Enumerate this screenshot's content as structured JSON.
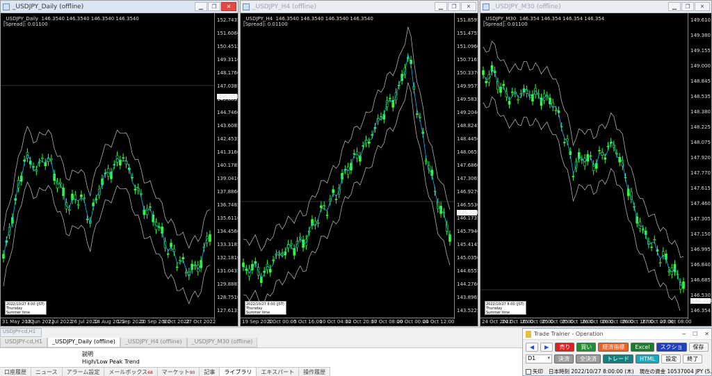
{
  "charts": [
    {
      "title": "_USDJPY_Daily (offline)",
      "info": "_USDJPY_Daily  146.3540 146.3540 146.3540 146.3540\n[Spread]: 0.01100",
      "price_labels": [
        "152.7435",
        "151.6060",
        "150.4515",
        "149.3110",
        "148.1760",
        "147.0385",
        "145.8835",
        "144.7460",
        "143.6085",
        "142.4535",
        "141.3160",
        "140.1785",
        "139.0410",
        "137.8860",
        "136.7485",
        "135.6110",
        "134.4560",
        "133.3185",
        "132.1810",
        "131.0435",
        "129.8885",
        "128.7510",
        "127.6135"
      ],
      "current_price": "146.3540",
      "time_labels": [
        "31 May 2022",
        "19 Jun 2022",
        "7 Jul 2022",
        "26 Jul 2022",
        "14 Aug 2022",
        "1 Sep 2022",
        "20 Sep 2022",
        "9 Oct 2022",
        "27 Oct 2022"
      ]
    },
    {
      "title": "_USDJPY_H4 (offline)",
      "info": "_USDJPY_H4  146.3540 146.3540 146.3540 146.3540\n[Spread]: 0.01100",
      "price_labels": [
        "151.8595",
        "151.4755",
        "151.0960",
        "150.7165",
        "150.3370",
        "149.9575",
        "149.5835",
        "149.2040",
        "148.8245",
        "148.4450",
        "148.0655",
        "147.6860",
        "147.3065",
        "146.9270",
        "146.5530",
        "146.1735",
        "145.7940",
        "145.4145",
        "145.0350",
        "144.6555",
        "144.2760",
        "143.8965",
        "143.5225"
      ],
      "current_price": "146.3540",
      "time_labels": [
        "19 Sep 2022",
        "3 Oct 00:00",
        "5 Oct 16:00",
        "10 Oct 04:00",
        "12 Oct 20:00",
        "17 Oct 08:00",
        "20 Oct 00:00",
        "24 Oct 12:00"
      ]
    },
    {
      "title": "_USDJPY_M30 (offline)",
      "info": "_USDJPY_M30  146.354 146.354 146.354 146.354\n[Spread]: 0.01100",
      "price_labels": [
        "149.610",
        "149.380",
        "149.155",
        "149.000",
        "148.845",
        "148.535",
        "148.380",
        "148.225",
        "148.075",
        "147.920",
        "147.770",
        "147.615",
        "147.460",
        "147.305",
        "147.150",
        "146.995",
        "146.840",
        "146.685",
        "146.530",
        "146.354"
      ],
      "current_price": "146.354",
      "time_labels": [
        "24 Oct 2022",
        "24 Oct 16:00",
        "25 Oct 00:00",
        "25 Oct 08:00",
        "25 Oct 16:00",
        "26 Oct 00:00",
        "26 Oct 08:00",
        "26 Oct 16:00",
        "27 Oct 00:00",
        "27 Oct 08:00"
      ]
    }
  ],
  "mini_window": "USDJPY-cd,H1",
  "chart_tabs": [
    "USDJPY-cd,H1",
    "_USDJPY_Daily (offline)",
    "_USDJPY_H4 (offline)",
    "_USDJPY_M30 (offline)"
  ],
  "description": {
    "header": "説明",
    "item": "High/Low Peak Trend"
  },
  "terminal_tabs": [
    {
      "label": "口座履歴",
      "count": ""
    },
    {
      "label": "ニュース",
      "count": ""
    },
    {
      "label": "アラーム設定",
      "count": ""
    },
    {
      "label": "メールボックス",
      "count": "68"
    },
    {
      "label": "マーケット",
      "count": "90"
    },
    {
      "label": "記事",
      "count": ""
    },
    {
      "label": "ライブラリ",
      "count": ""
    },
    {
      "label": "エキスパート",
      "count": ""
    },
    {
      "label": "操作履歴",
      "count": ""
    }
  ],
  "trainer": {
    "title": "Trade Trainer - Operation",
    "prev": "◀",
    "next": "▶",
    "sell": "売り",
    "buy": "買い",
    "economic": "経済指標",
    "excel": "Excel",
    "screenshot": "スクショ",
    "save": "保存",
    "timeframe": "D1",
    "settle": "決済",
    "settle_all": "全決済",
    "trade": "トレード",
    "html": "HTML",
    "settings": "設定",
    "exit": "終了",
    "arrow_label": "矢印",
    "jp_time": "日本時刻 2022/10/27 8:00:00 (木)",
    "funds": "現在の資金 10537004 JPY (5.37%)"
  },
  "colors": {
    "candle": "#33ff33",
    "ma": "#00bfff",
    "band": "#b0b0b0"
  }
}
